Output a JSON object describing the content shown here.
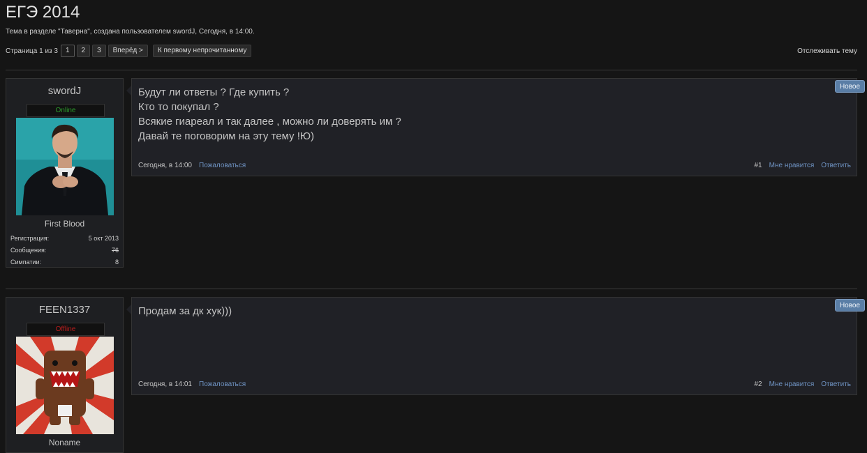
{
  "thread": {
    "title": "ЕГЭ 2014",
    "meta": "Тема в разделе \"Таверна\", создана пользователем swordJ, Сегодня, в 14:00."
  },
  "pagination": {
    "label": "Страница 1 из 3",
    "pages": [
      "1",
      "2",
      "3"
    ],
    "current": "1",
    "next": "Вперёд >",
    "first_unread": "К первому непрочитанному"
  },
  "watch_label": "Отслеживать тему",
  "posts": [
    {
      "username": "swordJ",
      "status": "Online",
      "user_title": "First Blood",
      "stats": [
        {
          "label": "Регистрация:",
          "value": "5 окт 2013"
        },
        {
          "label": "Сообщения:",
          "value": "76"
        },
        {
          "label": "Симпатии:",
          "value": "8"
        }
      ],
      "lines": [
        "Будут ли ответы ? Где купить ?",
        "Кто то покупал ?",
        "Всякие гиареал и так далее , можно ли доверять им ?",
        "Давай те поговорим на эту тему !Ю)"
      ],
      "date": "Сегодня, в 14:00",
      "report": "Пожаловаться",
      "number": "#1",
      "like": "Мне нравится",
      "reply": "Ответить",
      "badge": "Новое",
      "avatar_icon": "man-in-suit-avatar"
    },
    {
      "username": "FEEN1337",
      "status": "Offline",
      "user_title": "Noname",
      "lines": [
        "Продам за дк хук)))"
      ],
      "date": "Сегодня, в 14:01",
      "report": "Пожаловаться",
      "number": "#2",
      "like": "Мне нравится",
      "reply": "Ответить",
      "badge": "Новое",
      "avatar_icon": "domo-kun-avatar"
    }
  ],
  "colors": {
    "background": "#151515",
    "panel": "#202126",
    "link": "#6f93c3",
    "online": "#2c9a2c",
    "offline": "#b81d1d",
    "badge": "#5a7ea6"
  }
}
